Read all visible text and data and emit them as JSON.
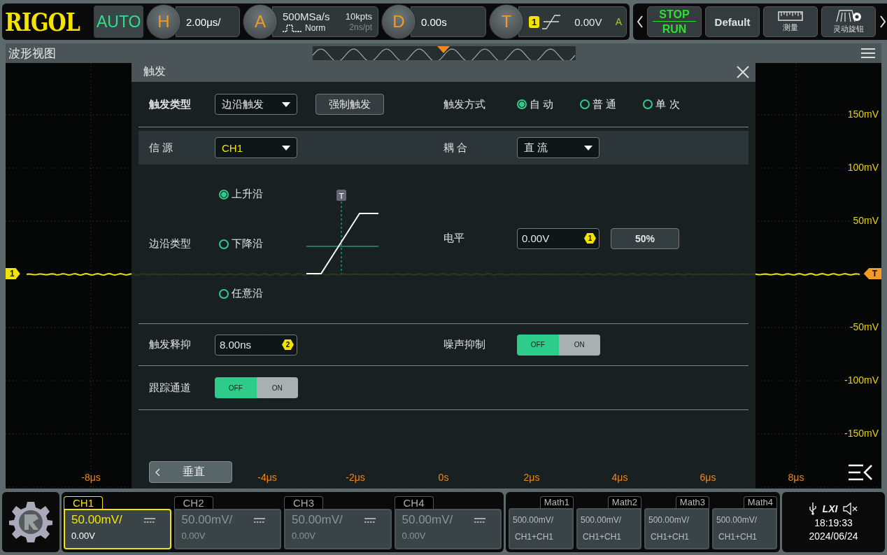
{
  "top_bar": {
    "logo": "RIGOL",
    "mode": "AUTO",
    "horizontal": {
      "badge": "H",
      "value": "2.00μs/"
    },
    "acquire": {
      "badge": "A",
      "sample_rate": "500MSa/s",
      "acq_mode": "Norm",
      "memory_depth": "10kpts",
      "resolution": "2ns/pt"
    },
    "delay": {
      "badge": "D",
      "value": "0.00s"
    },
    "trigger": {
      "badge": "T",
      "source": "1",
      "level": "0.00V",
      "status": "A"
    },
    "buttons": [
      {
        "kind": "stop_run",
        "top": "STOP",
        "bottom": "RUN"
      },
      {
        "kind": "default",
        "label": "Default"
      },
      {
        "kind": "measure",
        "label": "测量"
      },
      {
        "kind": "knob",
        "label": "灵动旋钮"
      }
    ]
  },
  "waveform_view": {
    "title": "波形视图",
    "channel_marker": "1",
    "trigger_marker": "T",
    "y_labels": [
      "150mV",
      "100mV",
      "50mV",
      "-50mV",
      "-100mV",
      "-150mV"
    ],
    "x_labels": [
      "-8μs",
      "-4μs",
      "-2μs",
      "0s",
      "2μs",
      "4μs",
      "6μs",
      "8μs"
    ]
  },
  "dialog": {
    "title": "触发",
    "trigger_type": {
      "label": "触发类型",
      "value": "边沿触发"
    },
    "force_button": "强制触发",
    "sweep": {
      "label": "触发方式",
      "options": [
        {
          "label": "自 动",
          "selected": true
        },
        {
          "label": "普 通",
          "selected": false
        },
        {
          "label": "单 次",
          "selected": false
        }
      ]
    },
    "source": {
      "label": "信 源",
      "value": "CH1"
    },
    "coupling": {
      "label": "耦 合",
      "value": "直 流"
    },
    "slope": {
      "label": "边沿类型",
      "options": [
        {
          "label": "上升沿",
          "selected": true
        },
        {
          "label": "下降沿",
          "selected": false
        },
        {
          "label": "任意沿",
          "selected": false
        }
      ],
      "marker": "T"
    },
    "level": {
      "label": "电平",
      "value": "0.00V",
      "badge": "1",
      "button": "50%"
    },
    "holdoff": {
      "label": "触发释抑",
      "value": "8.00ns",
      "badge": "2"
    },
    "noise_reject": {
      "label": "噪声抑制",
      "on": false,
      "off_text": "OFF",
      "on_text": "ON"
    },
    "track": {
      "label": "跟踪通道",
      "on": false,
      "off_text": "OFF",
      "on_text": "ON"
    },
    "back_button": "垂直"
  },
  "channels": [
    {
      "name": "CH1",
      "scale": "50.00mV/",
      "offset": "0.00V",
      "selected": true
    },
    {
      "name": "CH2",
      "scale": "50.00mV/",
      "offset": "0.00V",
      "selected": false
    },
    {
      "name": "CH3",
      "scale": "50.00mV/",
      "offset": "0.00V",
      "selected": false
    },
    {
      "name": "CH4",
      "scale": "50.00mV/",
      "offset": "0.00V",
      "selected": false
    }
  ],
  "math": [
    {
      "name": "Math1",
      "scale": "500.00mV/",
      "source": "CH1+CH1"
    },
    {
      "name": "Math2",
      "scale": "500.00mV/",
      "source": "CH1+CH1"
    },
    {
      "name": "Math3",
      "scale": "500.00mV/",
      "source": "CH1+CH1"
    },
    {
      "name": "Math4",
      "scale": "500.00mV/",
      "source": "CH1+CH1"
    }
  ],
  "status": {
    "lxi": "LXI",
    "time": "18:19:33",
    "date": "2024/06/24"
  }
}
